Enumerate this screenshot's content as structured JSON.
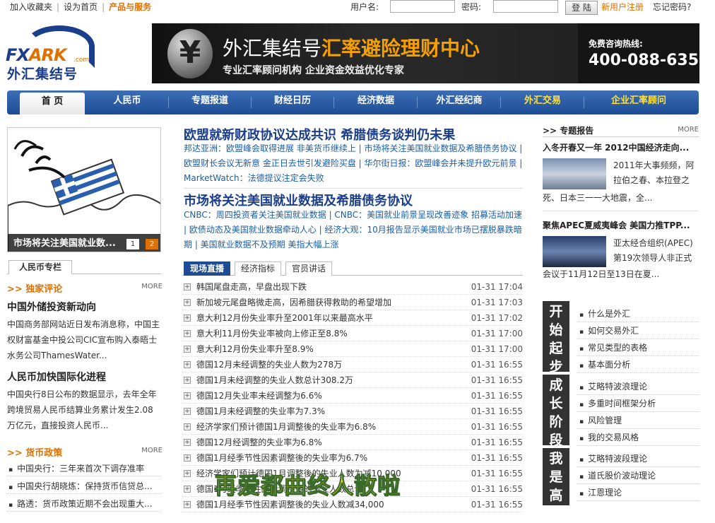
{
  "topbar": {
    "links": [
      "加入收藏夹",
      "设为首页",
      "产品与服务"
    ],
    "username_label": "用户名:",
    "password_label": "密码:",
    "login_button": "登 陆",
    "register": "新用户注册",
    "forgot": "忘记密码?"
  },
  "logo": {
    "brand_a": "FX",
    "brand_b": "ARK",
    "dotcom": ".com",
    "cn": "外汇集结号"
  },
  "banner": {
    "title_a": "外汇集结号",
    "title_b": "汇率避险理财中心",
    "subtitle": "专业汇率顾问机构 企业资金效益优化专家",
    "hotline_label": "免费咨询热线:",
    "hotline": "400-088-6358"
  },
  "nav": [
    "首 页",
    "人民币",
    "专题报道",
    "财经日历",
    "经济数据",
    "外汇经纪商",
    "外汇交易",
    "企业汇率顾问"
  ],
  "featured": {
    "caption": "市场将关注美国就业数...",
    "page1": "1",
    "page2": "2"
  },
  "left": {
    "tab": "人民币专栏",
    "section1": {
      "title": ">> 独家评论",
      "more": "MORE"
    },
    "articles": [
      {
        "title": "中国外储投资新动向",
        "body": "中国商务部网站近日发布消息称，中国主权财富基金中投公司CIC宣布购入泰晤士水务公司ThamesWater..."
      },
      {
        "title": "人民币加快国际化进程",
        "body": "中国央行8日公布的数据显示，去年全年跨境贸易人民币结算业务累计发生2.08万亿元，直接投资人民币..."
      }
    ],
    "section2": {
      "title": ">> 货币政策",
      "more": "MORE"
    },
    "policy": [
      "中国央行：三年来首次下调存准率",
      "中国央行胡晓炼：保持货币信贷总...",
      "路透：货币政策近期不会出现重大..."
    ]
  },
  "middle": {
    "headline1": "欧盟就新财政协议达成共识 希腊债务谈判仍未果",
    "body1": "邦达亚洲：欧盟峰会取得进展 非美货币继续上 | 市场将关注美国就业数据及希腊债务协议 | 欧盟财长会议无新意 金正日去世引发避险买盘 | 华尔街日报：欧盟峰会并未提升欧元前景 | MarketWatch：法德提议注定会失败",
    "headline2": "市场将关注美国就业数据及希腊债务协议",
    "body2": "CNBC：周四投资者关注美国就业数据 | CNBC：美国就业前景呈现改善迹象 招募活动加速 | 欧债动态及美国就业数据牵动人心 | 经济大观：10月报告显示美国就业市场已摆脱暴跌暗期 | 美国就业数据不及预期 美指大幅上涨",
    "tabs": [
      "现场直播",
      "经济指标",
      "官员讲话"
    ],
    "news": [
      {
        "t": "韩国尾盘走高，早盘出现下跌",
        "d": "01-31 17:04"
      },
      {
        "t": "新加坡元尾盘略微走高，因希腊获得救助的希望增加",
        "d": "01-31 17:03"
      },
      {
        "t": "意大利12月份失业率升至2001年以来最高水平",
        "d": "01-31 17:02"
      },
      {
        "t": "意大利11月份失业率被向上修正至8.8%",
        "d": "01-31 17:00"
      },
      {
        "t": "意大利12月份失业率升至8.9%",
        "d": "01-31 17:00"
      },
      {
        "t": "德国12月未经调整的失业人数为278万",
        "d": "01-31 16:55"
      },
      {
        "t": "德国1月未经调整的失业人数总计308.2万",
        "d": "01-31 16:55"
      },
      {
        "t": "德国12月失业率未经调整为6.6%",
        "d": "01-31 16:55"
      },
      {
        "t": "德国1月未经调整的失业率为7.3%",
        "d": "01-31 16:55"
      },
      {
        "t": "经济学家们预计德国1月调整後的失业率为6.8%",
        "d": "01-31 16:55"
      },
      {
        "t": "德国12月经调整的失业率为6.8%",
        "d": "01-31 16:55"
      },
      {
        "t": "德国1月经季节性因素调整後的失业率为6.7%",
        "d": "01-31 16:55"
      },
      {
        "t": "经济学家们预计德国1月调整後的失业人数为减10,000",
        "d": "01-31 16:55"
      },
      {
        "t": "德国1月经季节性因素调整後的失业人数总计",
        "d": "01-31 16:55"
      },
      {
        "t": "德国1月经季节性因素调整後的失业人数减34,000",
        "d": "01-31 16:55"
      }
    ]
  },
  "right": {
    "header": ">> 专题报告",
    "more": "MORE",
    "art1": {
      "title": "入冬开春又一年 2012中国经济走向...",
      "body_side": "2011年大事频频，阿拉伯之春、本拉登之",
      "body_full": "死、日本三一一大地震，全..."
    },
    "art2": {
      "title": "聚焦APEC夏威夷峰会 美国力推TPP...",
      "body_side": "亚太经合组织(APEC)第19次领导人非正式",
      "body_full": "会议于11月12日至13日在夏..."
    },
    "groups": [
      {
        "label": "开始起步",
        "items": [
          "什么是外汇",
          "如何交易外汇",
          "常见类型的表格",
          "基本面分析"
        ]
      },
      {
        "label": "成长阶段",
        "items": [
          "艾略特波浪理论",
          "多重时间框架分析",
          "风险管理",
          "我的交易风格"
        ]
      },
      {
        "label": "我是高手",
        "items": [
          "艾略特波段理论",
          "道氏股价波动理论",
          "江恩理论"
        ]
      }
    ]
  },
  "overlay": "再爱都曲终人散啦"
}
